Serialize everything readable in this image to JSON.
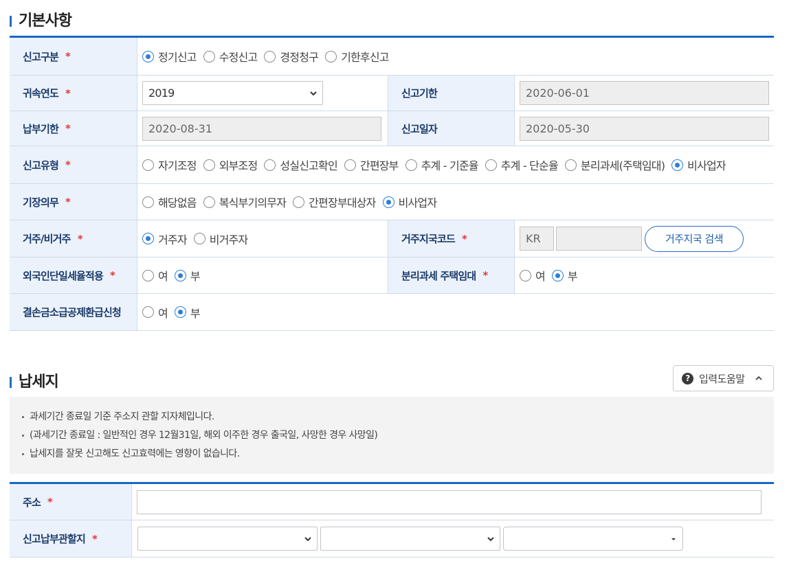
{
  "basic": {
    "title": "기본사항",
    "report_type": {
      "label": "신고구분",
      "options": [
        "정기신고",
        "수정신고",
        "경정청구",
        "기한후신고"
      ],
      "selected": 0
    },
    "year": {
      "label": "귀속연도",
      "value": "2019"
    },
    "deadline": {
      "label": "신고기한",
      "value": "2020-06-01"
    },
    "pay_deadline": {
      "label": "납부기한",
      "value": "2020-08-31"
    },
    "report_date": {
      "label": "신고일자",
      "value": "2020-05-30"
    },
    "report_kind": {
      "label": "신고유형",
      "options": [
        "자기조정",
        "외부조정",
        "성실신고확인",
        "간편장부",
        "추계 - 기준율",
        "추계 - 단순율",
        "분리과세(주택임대)",
        "비사업자"
      ],
      "selected": 7
    },
    "bookkeeping": {
      "label": "기장의무",
      "options": [
        "해당없음",
        "복식부기의무자",
        "간편장부대상자",
        "비사업자"
      ],
      "selected": 3
    },
    "residency": {
      "label": "거주/비거주",
      "options": [
        "거주자",
        "비거주자"
      ],
      "selected": 0
    },
    "country": {
      "label": "거주지국코드",
      "code": "KR",
      "search_label": "거주지국 검색"
    },
    "flat_rate": {
      "label": "외국인단일세율적용",
      "options": [
        "여",
        "부"
      ],
      "selected": 1
    },
    "rental": {
      "label": "분리과세 주택임대",
      "options": [
        "여",
        "부"
      ],
      "selected": 1
    },
    "deficit": {
      "label": "결손금소급공제환급신청",
      "options": [
        "여",
        "부"
      ],
      "selected": 1
    },
    "required_mark": "*"
  },
  "taxplace": {
    "title": "납세지",
    "help_label": "입력도움말",
    "notes": [
      "과세기간 종료일 기준 주소지 관할 지자체입니다.",
      "(과세기간 종료일 : 일반적인 경우 12월31일, 해외 이주한 경우 출국일, 사망한 경우 사망일)",
      "납세지를 잘못 신고해도 신고효력에는 영향이 없습니다."
    ],
    "address": {
      "label": "주소",
      "value": ""
    },
    "jurisdiction": {
      "label": "신고납부관할지"
    }
  },
  "colors": {
    "accent": "#1667c4",
    "header_bg": "#ebf2fb",
    "required": "#e03a3a"
  }
}
